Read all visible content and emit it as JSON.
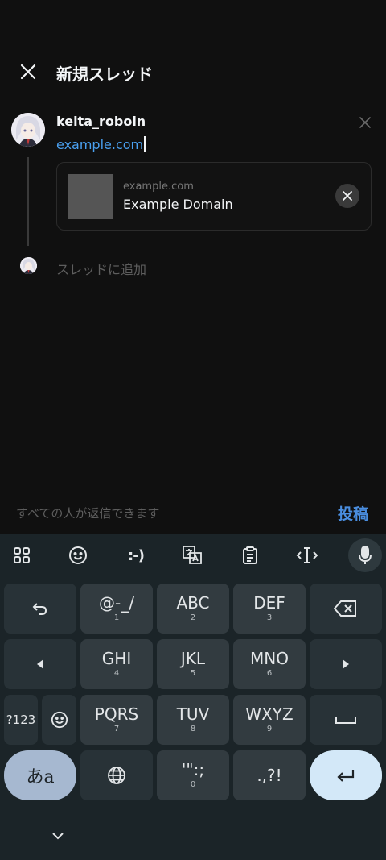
{
  "header": {
    "title": "新規スレッド"
  },
  "post": {
    "username": "keita_roboin",
    "text": "example.com",
    "link_preview": {
      "domain": "example.com",
      "title": "Example Domain"
    },
    "add_to_thread": "スレッドに追加"
  },
  "footer": {
    "reply_setting": "すべての人が返信できます",
    "post_label": "投稿"
  },
  "keyboard": {
    "toolbar": {
      "emoticon": ":-)"
    },
    "rows": [
      [
        {
          "main": "@-_/",
          "sub": "1"
        },
        {
          "main": "ABC",
          "sub": "2"
        },
        {
          "main": "DEF",
          "sub": "3"
        }
      ],
      [
        {
          "main": "GHI",
          "sub": "4"
        },
        {
          "main": "JKL",
          "sub": "5"
        },
        {
          "main": "MNO",
          "sub": "6"
        }
      ],
      [
        {
          "main": "PQRS",
          "sub": "7"
        },
        {
          "main": "TUV",
          "sub": "8"
        },
        {
          "main": "WXYZ",
          "sub": "9"
        }
      ],
      [
        {
          "main": "'\":;",
          "sub": "0"
        },
        {
          "main": ".,?!",
          "sub": ""
        }
      ]
    ],
    "mode_key": "?123",
    "kana_key": "あa"
  },
  "colors": {
    "accent": "#4a8ee0",
    "link": "#4aa0f0",
    "background": "#101010",
    "keyboard_bg": "#1b2428"
  }
}
